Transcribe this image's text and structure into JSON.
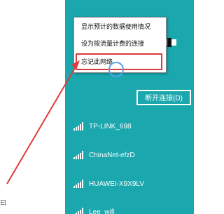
{
  "left_area": {
    "corner_text": "曰"
  },
  "menu": {
    "items": [
      "显示预计的数据使用情况",
      "设为按流量计费的连接",
      "忘记此网络"
    ]
  },
  "panel": {
    "disconnect_label": "断开连接(D)",
    "networks": [
      "TP-LINK_698",
      "ChinaNet-efzD",
      "HUAWEI-X9X9LV",
      "Lee_wifi"
    ]
  },
  "colors": {
    "panel_bg": "#1aa7ad",
    "highlight_border": "#e03b3b",
    "arrow": "#e03b3b"
  }
}
